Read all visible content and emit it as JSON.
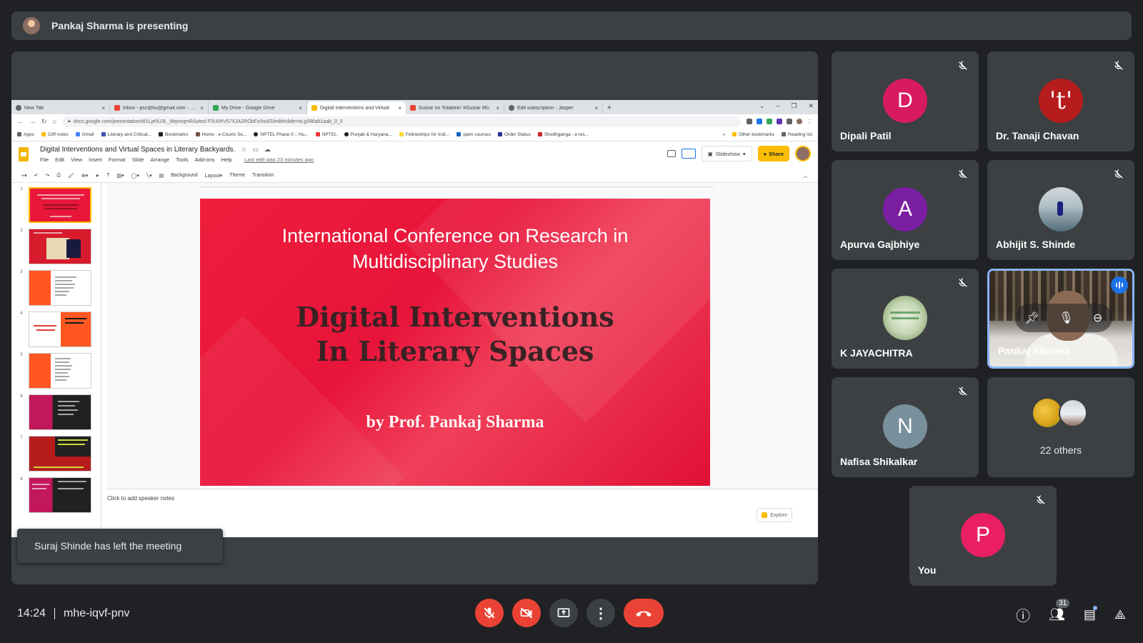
{
  "presenting": {
    "text": "Pankaj Sharma is presenting"
  },
  "browser": {
    "tabs": [
      {
        "label": "New Tab",
        "color": "#1a73e8"
      },
      {
        "label": "Inbox - psc@ku@gmail.com - Gm",
        "color": "#ea4335"
      },
      {
        "label": "My Drive - Google Drive",
        "color": "#34a853"
      },
      {
        "label": "Digital Interventions and Virtual",
        "color": "#fbbc04"
      },
      {
        "label": "Gulzar on 'Kitabein' #Gulzar #Ki",
        "color": "#ea4335"
      },
      {
        "label": "Edit subscription - Jasper",
        "color": "#5f6368"
      }
    ],
    "url": "docs.google.com/presentation/d/1Lje5U3L_MqnnqmRAztezl F5U0hV57XJA2RObFo/hu6S/edit#slide=id.g396ab1aab_0_0",
    "bookmarks": [
      "Apps",
      "Cliff notes",
      "Gmail",
      "Literary and Critical...",
      "Bookmarks",
      "Home : e-Courts Se...",
      "NPTEL Phase II :: Hu...",
      "NPTEL",
      "Punjab & Haryana...",
      "Fellowships for Indi...",
      "open courses",
      "Order Status",
      "Shodhganga : a res..."
    ],
    "bookmarks_right": [
      "Other bookmarks",
      "Reading list"
    ]
  },
  "slides": {
    "doc_title": "Digital Interventions and Virtual Spaces in Literary Backyards.",
    "menu": [
      "File",
      "Edit",
      "View",
      "Insert",
      "Format",
      "Slide",
      "Arrange",
      "Tools",
      "Add-ons",
      "Help"
    ],
    "last_edit": "Last edit was 23 minutes ago",
    "slideshow_label": "Slideshow",
    "share_label": "Share",
    "toolbar": [
      "Background",
      "Layout",
      "Theme",
      "Transition"
    ],
    "thumb_numbers": [
      "1",
      "2",
      "3",
      "4",
      "5",
      "6",
      "7",
      "8"
    ],
    "slide": {
      "conference_line1": "International Conference on Research in",
      "conference_line2": "Multidisciplinary Studies",
      "title_line1": "Digital Interventions",
      "title_line2": "In Literary Spaces",
      "byline": "by Prof. Pankaj Sharma"
    },
    "notes_placeholder": "Click to add speaker notes",
    "explore_label": "Explore"
  },
  "toast": {
    "text": "Suraj Shinde has left the meeting"
  },
  "participants": [
    {
      "name": "Dipali Patil",
      "letter": "D",
      "color": "#d81b60"
    },
    {
      "name": "Dr. Tanaji Chavan",
      "letter": "'t'",
      "color": "#b71c1c"
    },
    {
      "name": "Apurva Gajbhiye",
      "letter": "A",
      "color": "#7b1fa2"
    },
    {
      "name": "Abhijit S. Shinde"
    },
    {
      "name": "K JAYACHITRA"
    },
    {
      "name": "Pankaj Sharma"
    },
    {
      "name": "Nafisa Shikalkar",
      "letter": "N",
      "color": "#78909c"
    },
    {
      "others": "22 others"
    },
    {
      "name": "You",
      "letter": "P",
      "color": "#e91e63"
    }
  ],
  "bottom": {
    "time": "14:24",
    "meeting_code": "mhe-iqvf-pnv",
    "people_count": "31"
  }
}
